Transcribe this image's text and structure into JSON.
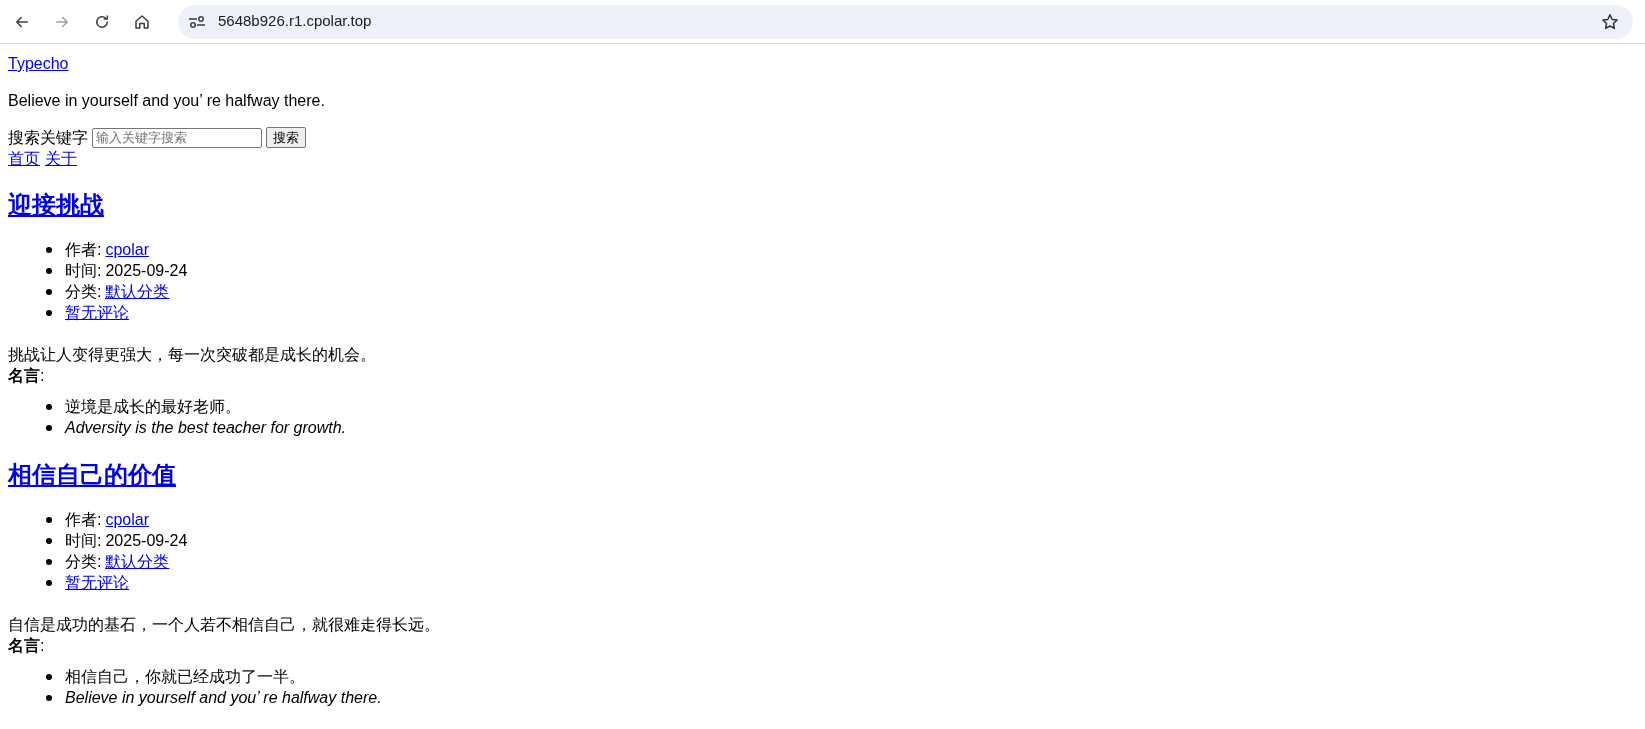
{
  "browser": {
    "nav_buttons": [
      {
        "kind": "back",
        "disabled": false
      },
      {
        "kind": "forward",
        "disabled": true
      },
      {
        "kind": "reload",
        "disabled": false
      },
      {
        "kind": "home",
        "disabled": false
      }
    ],
    "url": "5648b926.r1.cpolar.top",
    "bookmarked": false
  },
  "site": {
    "title": "Typecho",
    "description": "Believe in yourself and you’ re halfway there.",
    "search": {
      "label": "搜索关键字",
      "placeholder": "输入关键字搜索",
      "button": "搜索"
    },
    "nav": [
      "首页",
      "关于"
    ]
  },
  "posts": [
    {
      "title": "迎接挑战",
      "meta": [
        {
          "kind": "link",
          "label": "作者:",
          "value": "cpolar"
        },
        {
          "kind": "text",
          "label": "时间:",
          "value": "2025-09-24"
        },
        {
          "kind": "link",
          "label": "分类:",
          "value": "默认分类"
        },
        {
          "kind": "link",
          "value": "暂无评论"
        }
      ],
      "summary": "挑战让人变得更强大，每一次突破都是成长的机会。",
      "quote_label": "**名言**:",
      "quotes": [
        {
          "text": "逆境是成长的最好老师。",
          "italic": false
        },
        {
          "text": "Adversity is the best teacher for growth.",
          "italic": true
        }
      ]
    },
    {
      "title": "相信自己的价值",
      "meta": [
        {
          "kind": "link",
          "label": "作者:",
          "value": "cpolar"
        },
        {
          "kind": "text",
          "label": "时间:",
          "value": "2025-09-24"
        },
        {
          "kind": "link",
          "label": "分类:",
          "value": "默认分类"
        },
        {
          "kind": "link",
          "value": "暂无评论"
        }
      ],
      "summary": "自信是成功的基石，一个人若不相信自己，就很难走得长远。",
      "quote_label": "**名言**:",
      "quotes": [
        {
          "text": "相信自己，你就已经成功了一半。",
          "italic": false
        },
        {
          "text": "Believe in yourself and you’ re halfway there.",
          "italic": true
        }
      ]
    }
  ]
}
